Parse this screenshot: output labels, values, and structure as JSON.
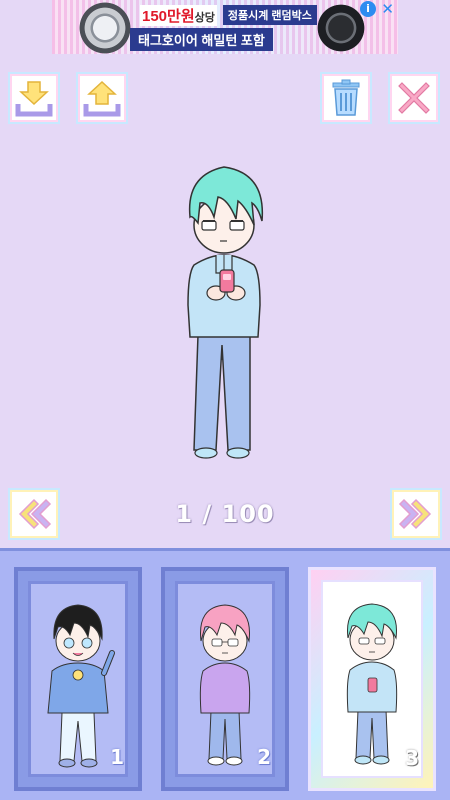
{
  "ad": {
    "price_text": "150만원",
    "price_suffix": "상당",
    "box_text": "정품시계 랜덤박스",
    "line2": "태그호이어 해밀턴 포함",
    "info_label": "i",
    "close_label": "✕"
  },
  "toolbar": {
    "download_icon": "download-icon",
    "upload_icon": "upload-icon",
    "trash_icon": "trash-icon",
    "close_icon": "close-icon"
  },
  "colors": {
    "background": "#e5d8f6",
    "panel": "#aab4f4",
    "hair_mint": "#7de8d8",
    "hair_pink": "#f7a2c2",
    "hair_black": "#1e1e1e"
  },
  "viewer": {
    "current": 1,
    "total": 100,
    "counter_text": "1 / 100"
  },
  "slots": [
    {
      "number": "1",
      "active": false
    },
    {
      "number": "2",
      "active": false
    },
    {
      "number": "3",
      "active": true
    }
  ]
}
